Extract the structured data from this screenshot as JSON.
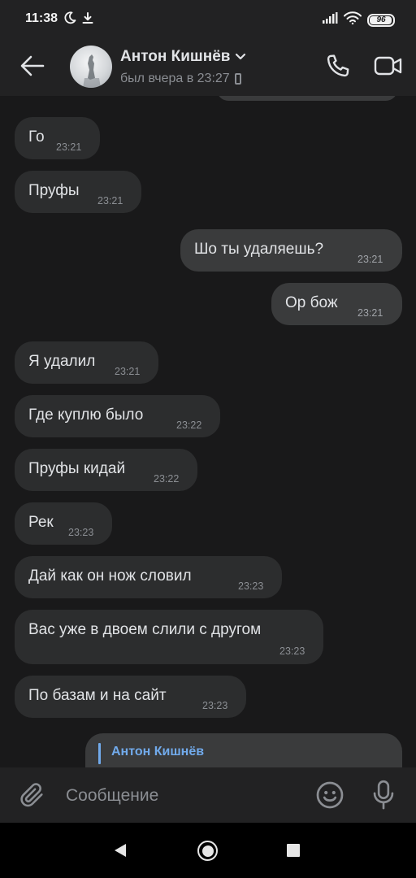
{
  "status_bar": {
    "time": "11:38",
    "battery": "96",
    "battery_level": 0.96,
    "icons": [
      "moon-icon",
      "download-icon",
      "signal-icon",
      "wifi-icon",
      "battery-icon"
    ]
  },
  "header": {
    "contact_name": "Антон Кишнёв",
    "last_seen": "был вчера в 23:27",
    "icons": [
      "back-arrow-icon",
      "chevron-down-icon",
      "mobile-device-icon",
      "phone-icon",
      "video-camera-icon"
    ]
  },
  "messages": [
    {
      "direction": "in",
      "text": "Го",
      "time": "23:21"
    },
    {
      "direction": "in",
      "text": "Пруфы",
      "time": "23:21"
    },
    {
      "direction": "out",
      "text": "Шо ты удаляешь?",
      "time": "23:21"
    },
    {
      "direction": "out",
      "text": "Ор бож",
      "time": "23:21"
    },
    {
      "direction": "in",
      "text": "Я удалил",
      "time": "23:21"
    },
    {
      "direction": "in",
      "text": "Где куплю было",
      "time": "23:22"
    },
    {
      "direction": "in",
      "text": "Пруфы кидай",
      "time": "23:22"
    },
    {
      "direction": "in",
      "text": "Рек",
      "time": "23:23"
    },
    {
      "direction": "in",
      "text": "Дай как он нож словил",
      "time": "23:23"
    },
    {
      "direction": "in",
      "text": "Вас уже в двоем слили с другом",
      "time": "23:23"
    },
    {
      "direction": "in",
      "text": "По базам и на сайт",
      "time": "23:23"
    }
  ],
  "reply_preview": {
    "author": "Антон Кишнёв"
  },
  "composer": {
    "placeholder": "Сообщение",
    "icons": [
      "paperclip-icon",
      "emoji-icon",
      "microphone-icon"
    ]
  },
  "colors": {
    "background": "#19191a",
    "bars": "#222223",
    "incoming_bubble": "#2c2d2e",
    "outgoing_bubble": "#3a3b3c",
    "accent": "#71aaeb",
    "secondary_text": "#8b8e93"
  }
}
